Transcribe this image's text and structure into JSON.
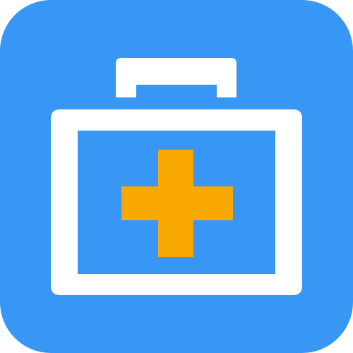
{
  "icon": {
    "name": "first-aid-kit-icon",
    "colors": {
      "background": "#3897f4",
      "outline": "#ffffff",
      "cross": "#f8a800"
    }
  }
}
